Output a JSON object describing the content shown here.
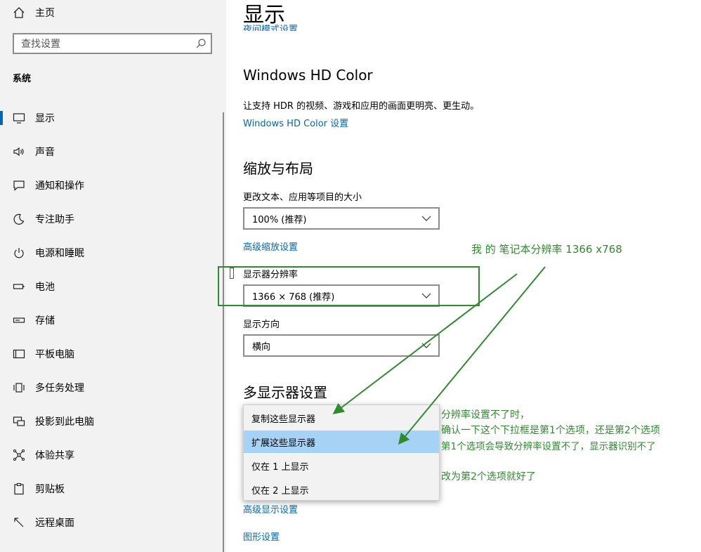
{
  "sidebar": {
    "home_label": "主页",
    "search_placeholder": "查找设置",
    "section_label": "系统",
    "items": [
      {
        "label": "显示",
        "icon": "monitor-icon"
      },
      {
        "label": "声音",
        "icon": "speaker-icon"
      },
      {
        "label": "通知和操作",
        "icon": "notification-icon"
      },
      {
        "label": "专注助手",
        "icon": "moon-icon"
      },
      {
        "label": "电源和睡眠",
        "icon": "power-icon"
      },
      {
        "label": "电池",
        "icon": "battery-icon"
      },
      {
        "label": "存储",
        "icon": "storage-icon"
      },
      {
        "label": "平板电脑",
        "icon": "tablet-icon"
      },
      {
        "label": "多任务处理",
        "icon": "multitask-icon"
      },
      {
        "label": "投影到此电脑",
        "icon": "project-icon"
      },
      {
        "label": "体验共享",
        "icon": "share-icon"
      },
      {
        "label": "剪贴板",
        "icon": "clipboard-icon"
      },
      {
        "label": "远程桌面",
        "icon": "remote-desktop-icon"
      }
    ]
  },
  "main": {
    "title": "显示",
    "clipped_link": "夜间模式设置",
    "hdr": {
      "heading": "Windows HD Color",
      "description": "让支持 HDR 的视频、游戏和应用的画面更明亮、更生动。",
      "link": "Windows HD Color 设置"
    },
    "scale": {
      "heading": "缩放与布局",
      "size_label": "更改文本、应用等项目的大小",
      "size_value": "100% (推荐)",
      "advanced_link": "高级缩放设置",
      "resolution_label": "显示器分辨率",
      "resolution_value": "1366 × 768 (推荐)",
      "orientation_label": "显示方向",
      "orientation_value": "横向"
    },
    "multi": {
      "heading": "多显示器设置",
      "options": [
        "复制这些显示器",
        "扩展这些显示器",
        "仅在 1 上显示",
        "仅在 2 上显示"
      ],
      "highlighted_index": 1,
      "advanced_display_link": "高级显示设置",
      "graphics_link": "图形设置"
    }
  },
  "annotations": {
    "resolution_note": "我 的 笔记本分辨率 1366 x768",
    "lines": [
      "分辨率设置不了时，",
      "确认一下这个下拉框是第1个选项，还是第2个选项",
      "第1个选项会导致分辨率设置不了，显示器识别不了",
      "改为第2个选项就好了"
    ],
    "color": "#2e8b2e"
  }
}
